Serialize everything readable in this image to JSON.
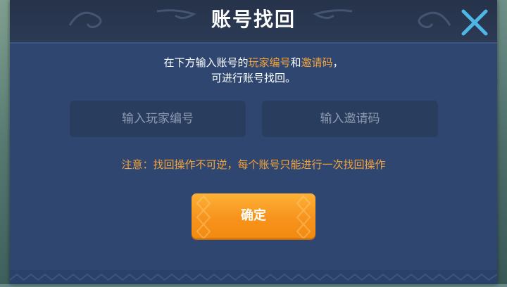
{
  "dialog": {
    "title": "账号找回",
    "description": {
      "line1_pre": "在下方输入账号的",
      "line1_hl1": "玩家编号",
      "line1_mid": "和",
      "line1_hl2": "邀请码",
      "line1_post": "，",
      "line2": "可进行账号找回。"
    },
    "player_id_input": {
      "placeholder": "输入玩家编号",
      "value": ""
    },
    "invite_code_input": {
      "placeholder": "输入邀请码",
      "value": ""
    },
    "notice": "注意：找回操作不可逆，每个账号只能进行一次找回操作",
    "confirm_label": "确定"
  },
  "icons": {
    "close": "close-x-icon"
  },
  "colors": {
    "accent": "#f5a33a",
    "dialog_bg": "#2f4770",
    "header_bg": "#26334a",
    "button": "#f7931c",
    "close_icon": "#4fb6e8"
  }
}
